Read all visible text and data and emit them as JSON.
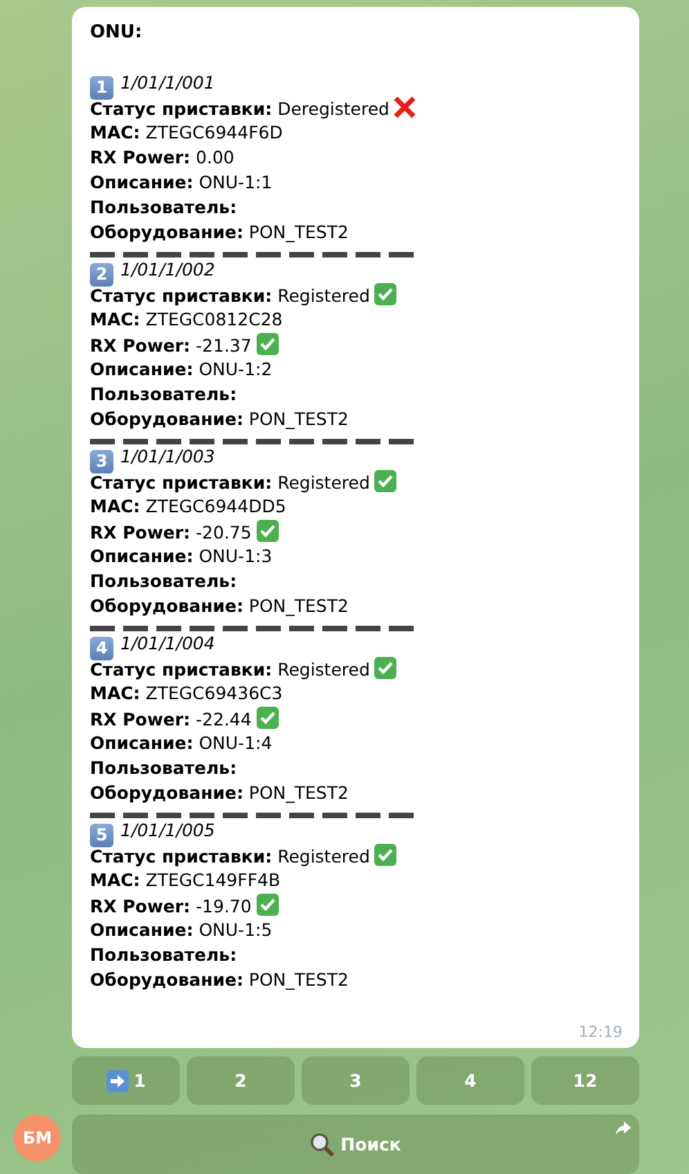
{
  "message": {
    "title": "ONU:",
    "time": "12:19",
    "entries": [
      {
        "number": "1",
        "port": "1/01/1/001",
        "fields": [
          {
            "label": "Статус приставки:",
            "value": "Deregistered",
            "ok": false
          },
          {
            "label": "MAC:",
            "value": "ZTEGC6944F6D"
          },
          {
            "label": "RX Power:",
            "value": "0.00"
          },
          {
            "label": "Описание:",
            "value": "ONU-1:1"
          },
          {
            "label": "Пользователь:"
          },
          {
            "label": "Оборудование:",
            "value": "PON_TEST2"
          }
        ]
      },
      {
        "number": "2",
        "port": "1/01/1/002",
        "fields": [
          {
            "label": "Статус приставки:",
            "value": "Registered",
            "ok": true
          },
          {
            "label": "MAC:",
            "value": "ZTEGC0812C28"
          },
          {
            "label": "RX Power:",
            "value": "-21.37",
            "ok": true
          },
          {
            "label": "Описание:",
            "value": "ONU-1:2"
          },
          {
            "label": "Пользователь:"
          },
          {
            "label": "Оборудование:",
            "value": "PON_TEST2"
          }
        ]
      },
      {
        "number": "3",
        "port": "1/01/1/003",
        "fields": [
          {
            "label": "Статус приставки:",
            "value": "Registered",
            "ok": true
          },
          {
            "label": "MAC:",
            "value": "ZTEGC6944DD5"
          },
          {
            "label": "RX Power:",
            "value": "-20.75",
            "ok": true
          },
          {
            "label": "Описание:",
            "value": "ONU-1:3"
          },
          {
            "label": "Пользователь:"
          },
          {
            "label": "Оборудование:",
            "value": "PON_TEST2"
          }
        ]
      },
      {
        "number": "4",
        "port": "1/01/1/004",
        "fields": [
          {
            "label": "Статус приставки:",
            "value": "Registered",
            "ok": true
          },
          {
            "label": "MAC:",
            "value": "ZTEGC69436C3"
          },
          {
            "label": "RX Power:",
            "value": "-22.44",
            "ok": true
          },
          {
            "label": "Описание:",
            "value": "ONU-1:4"
          },
          {
            "label": "Пользователь:"
          },
          {
            "label": "Оборудование:",
            "value": "PON_TEST2"
          }
        ]
      },
      {
        "number": "5",
        "port": "1/01/1/005",
        "fields": [
          {
            "label": "Статус приставки:",
            "value": "Registered",
            "ok": true
          },
          {
            "label": "MAC:",
            "value": "ZTEGC149FF4B"
          },
          {
            "label": "RX Power:",
            "value": "-19.70",
            "ok": true
          },
          {
            "label": "Описание:",
            "value": "ONU-1:5"
          },
          {
            "label": "Пользователь:"
          },
          {
            "label": "Оборудование:",
            "value": "PON_TEST2"
          }
        ]
      }
    ]
  },
  "keyboard": {
    "pages": [
      {
        "label": "1",
        "selected": true
      },
      {
        "label": "2",
        "selected": false
      },
      {
        "label": "3",
        "selected": false
      },
      {
        "label": "4",
        "selected": false
      },
      {
        "label": "12",
        "selected": false
      }
    ],
    "search_button": "Поиск"
  },
  "avatar": {
    "initials": "БМ"
  }
}
